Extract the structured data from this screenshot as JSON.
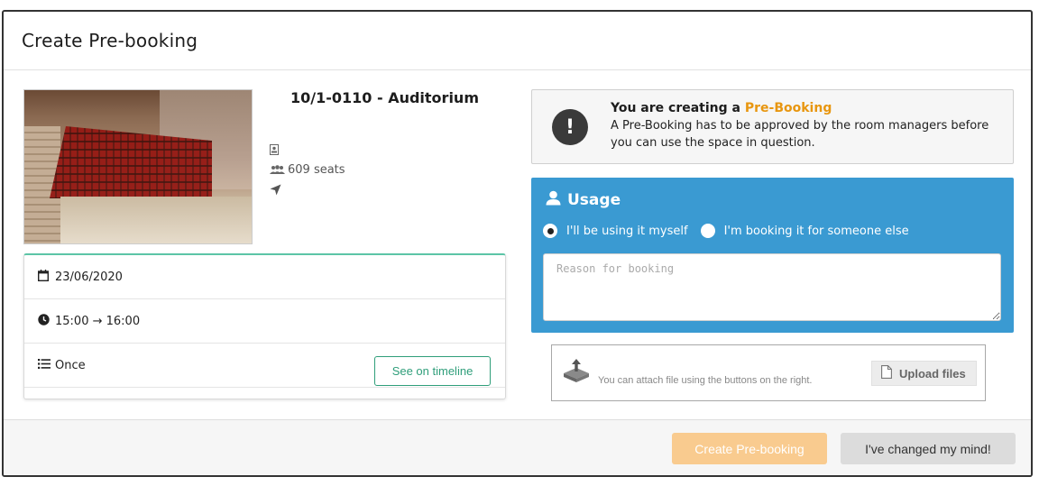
{
  "dialog": {
    "title": "Create Pre-booking"
  },
  "room": {
    "name": "10/1-0110 - Auditorium",
    "seats": "609 seats",
    "icons": [
      "badge-icon",
      "users-icon",
      "location-arrow-icon"
    ]
  },
  "booking": {
    "date": "23/06/2020",
    "time": "15:00 → 16:00",
    "recurrence": "Once",
    "timeline_button": "See on timeline"
  },
  "notice": {
    "title_prefix": "You are creating a ",
    "title_highlight": "Pre-Booking",
    "body": "A Pre-Booking has to be approved by the room managers before you can use the space in question.",
    "highlight_color": "#e8960f"
  },
  "usage": {
    "title": "Usage",
    "option_self": "I'll be using it myself",
    "option_other": "I'm booking it for someone else",
    "selected": "self",
    "reason_placeholder": "Reason for booking",
    "panel_color": "#3a9ad2"
  },
  "attachments": {
    "hint": "You can attach file using the buttons on the right.",
    "upload_button": "Upload files"
  },
  "footer": {
    "create_button": "Create Pre-booking",
    "cancel_button": "I've changed my mind!",
    "create_color": "#f9cb8f"
  }
}
